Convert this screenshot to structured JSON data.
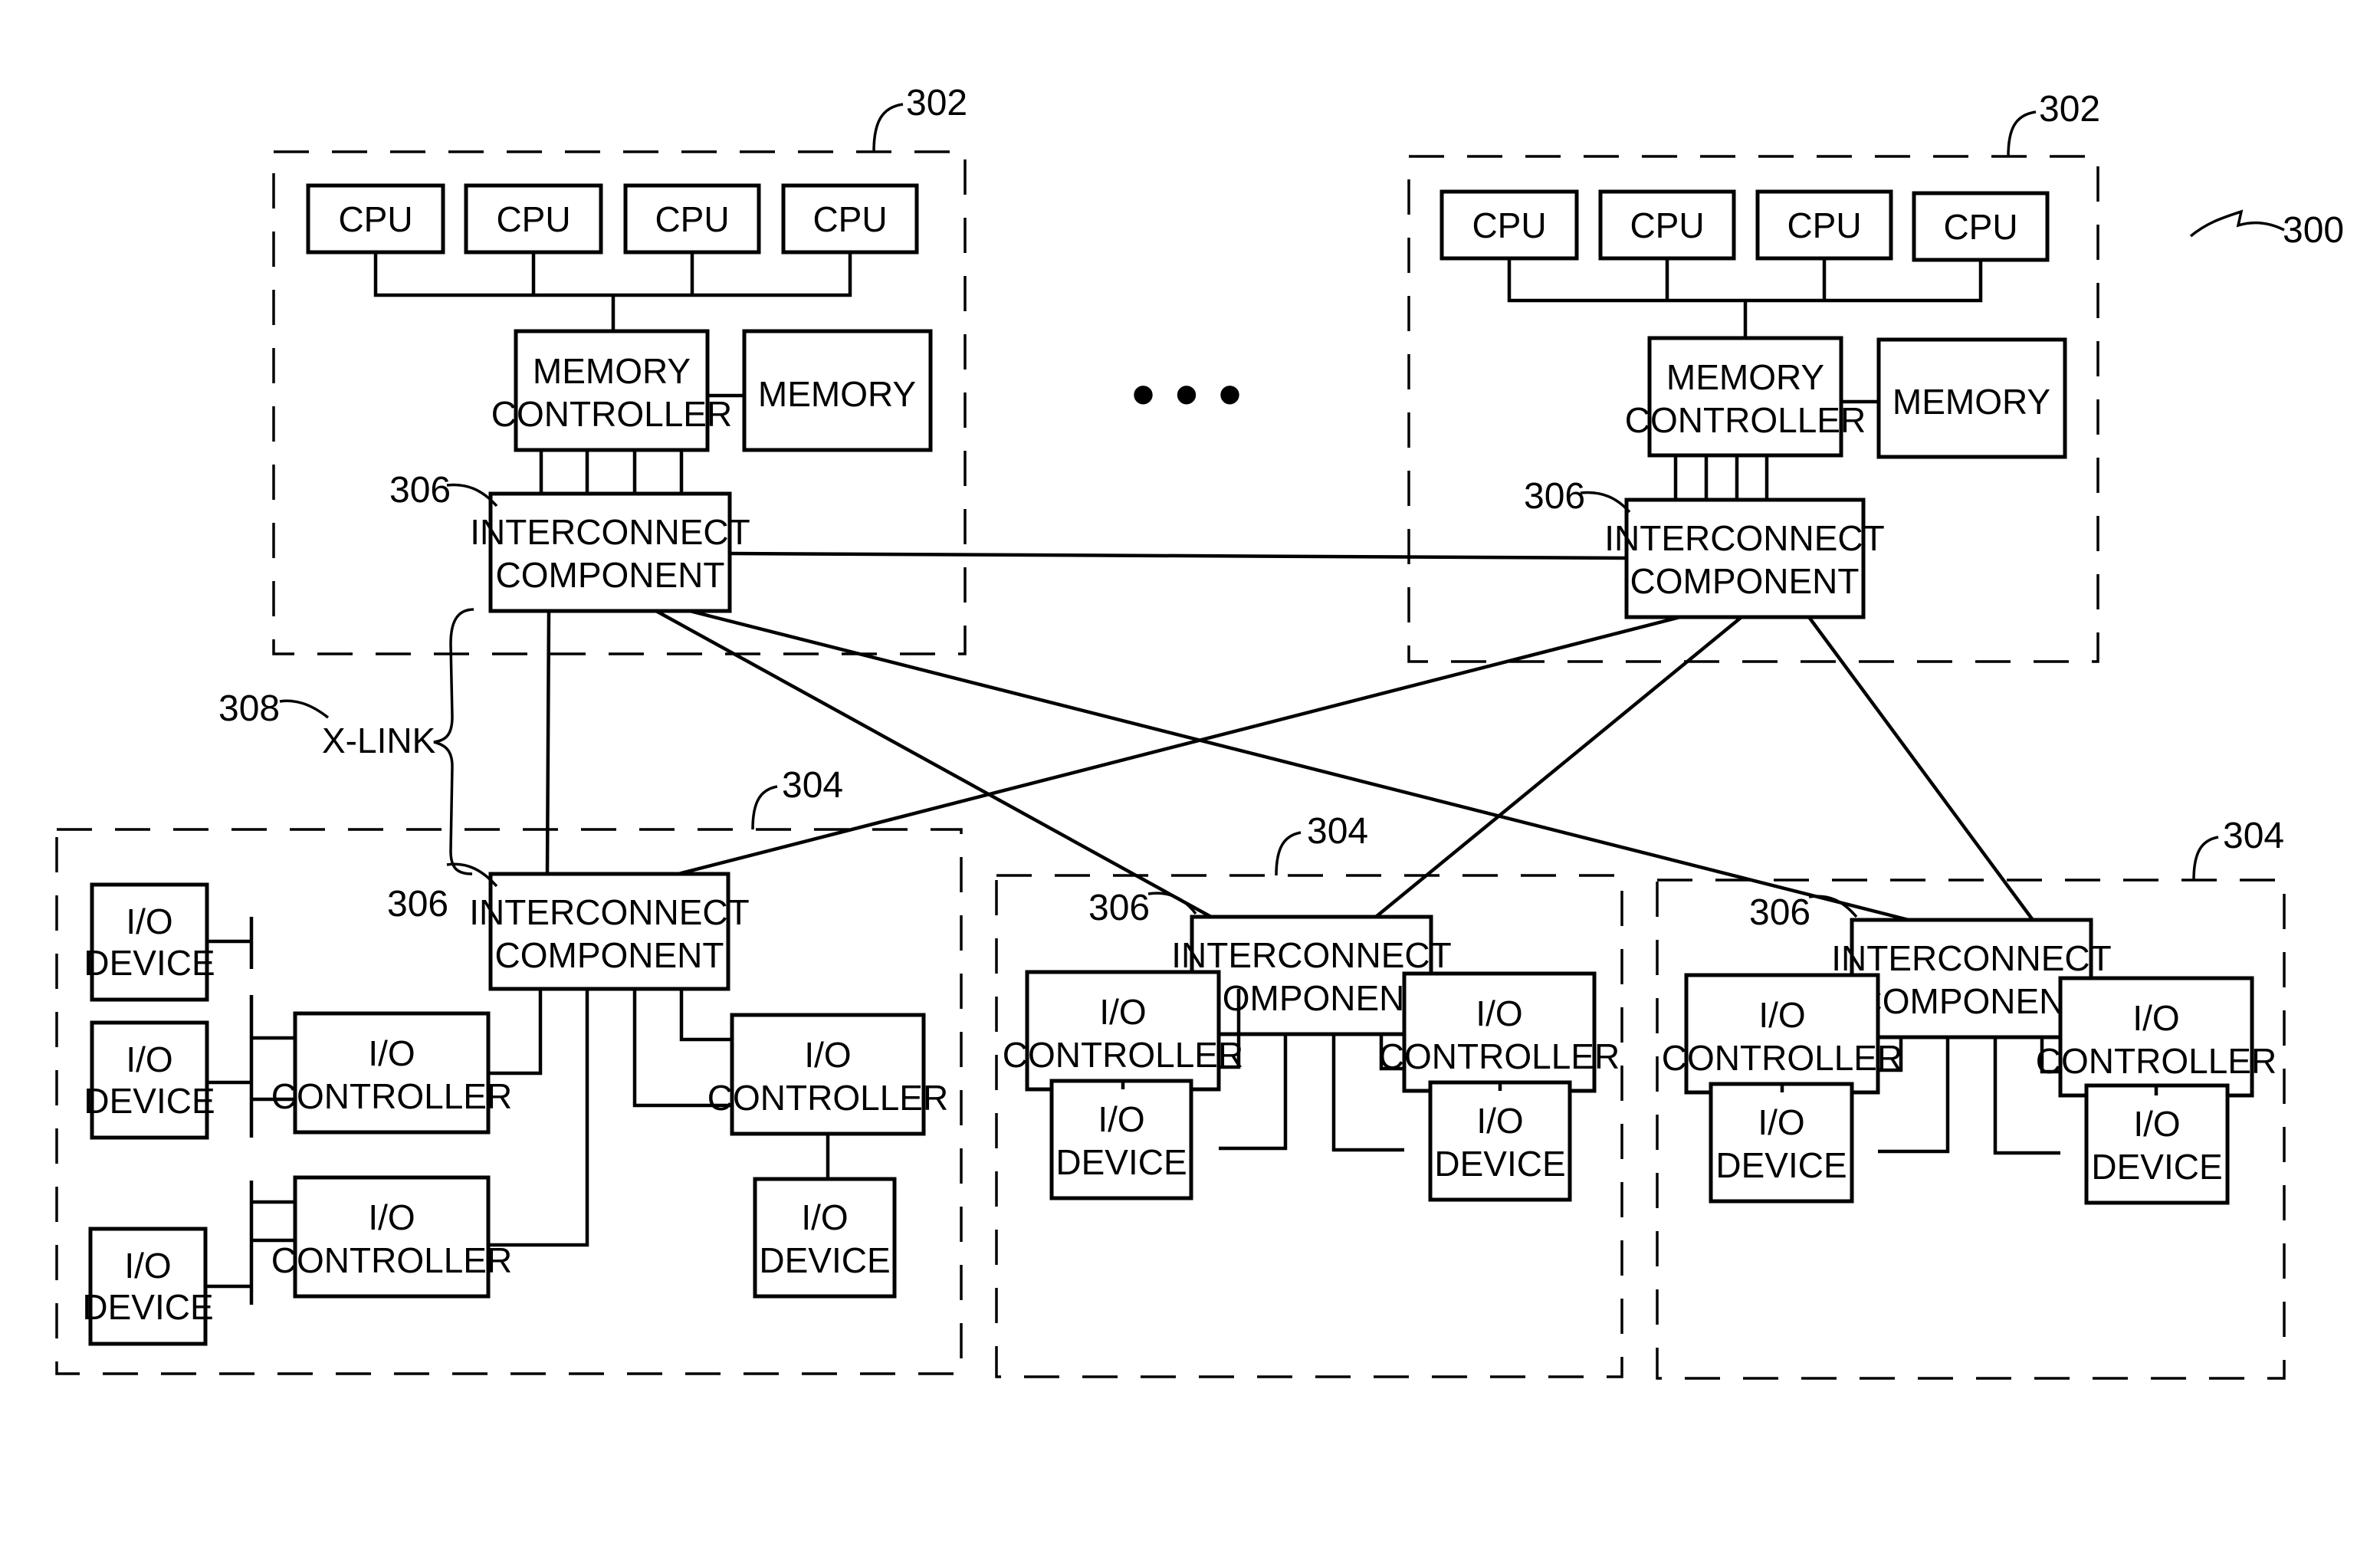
{
  "figure": {
    "ref": "300",
    "labels": {
      "cpu": "CPU",
      "memory_controller": [
        "MEMORY",
        "CONTROLLER"
      ],
      "memory": "MEMORY",
      "interconnect": [
        "INTERCONNECT",
        "COMPONENT"
      ],
      "io_controller": [
        "I/O",
        "CONTROLLER"
      ],
      "io_device": [
        "I/O",
        "DEVICE"
      ],
      "xlink": "X-LINK",
      "ellipsis": "• • •"
    },
    "refs": {
      "processing_node": "302",
      "io_node": "304",
      "interconnect": "306",
      "xlink": "308",
      "system": "300"
    }
  },
  "processing_nodes": [
    {
      "id": "left",
      "ref": "302",
      "cpus": [
        "CPU",
        "CPU",
        "CPU",
        "CPU"
      ],
      "interconnect_ref": "306"
    },
    {
      "id": "right",
      "ref": "302",
      "cpus": [
        "CPU",
        "CPU",
        "CPU",
        "CPU"
      ],
      "interconnect_ref": "306"
    }
  ],
  "io_nodes": [
    {
      "id": "io-left",
      "ref": "304",
      "interconnect_ref": "306",
      "controllers": 3,
      "devices": 4
    },
    {
      "id": "io-mid",
      "ref": "304",
      "interconnect_ref": "306",
      "controllers": 2,
      "devices": 2
    },
    {
      "id": "io-right",
      "ref": "304",
      "interconnect_ref": "306",
      "controllers": 2,
      "devices": 2
    }
  ]
}
